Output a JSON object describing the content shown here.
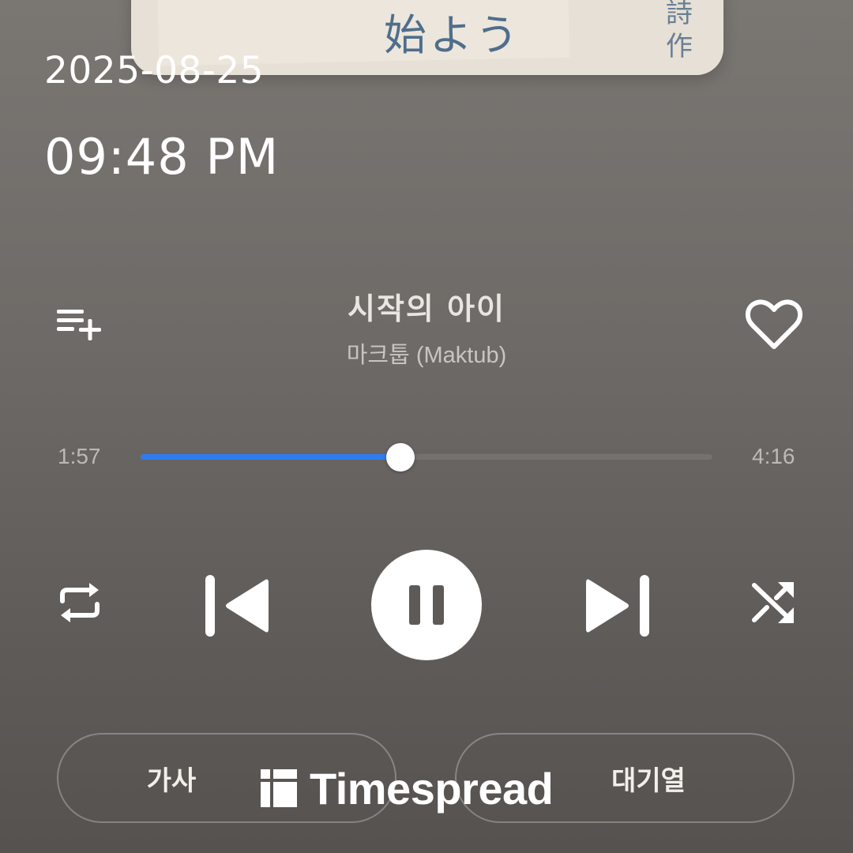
{
  "album_art": {
    "title_glyphs": "始よう",
    "side_glyphs": [
      "詩",
      "作"
    ]
  },
  "status": {
    "date": "2025-08-25",
    "time": "09:48 PM"
  },
  "track": {
    "title": "시작의 아이",
    "artist": "마크툽 (Maktub)"
  },
  "progress": {
    "elapsed": "1:57",
    "total": "4:16",
    "fraction": 0.455
  },
  "controls": {
    "add_to_playlist_icon": "playlist-add-icon",
    "like_icon": "heart-outline-icon",
    "repeat_icon": "repeat-icon",
    "previous_icon": "skip-previous-icon",
    "play_pause_icon": "pause-icon",
    "next_icon": "skip-next-icon",
    "shuffle_icon": "shuffle-icon"
  },
  "tabs": {
    "lyrics_label": "가사",
    "queue_label": "대기열"
  },
  "watermark": {
    "text": "Timespread"
  },
  "colors": {
    "accent": "#2f7cf0",
    "track": "#75716e",
    "background": "#6e6a67"
  }
}
